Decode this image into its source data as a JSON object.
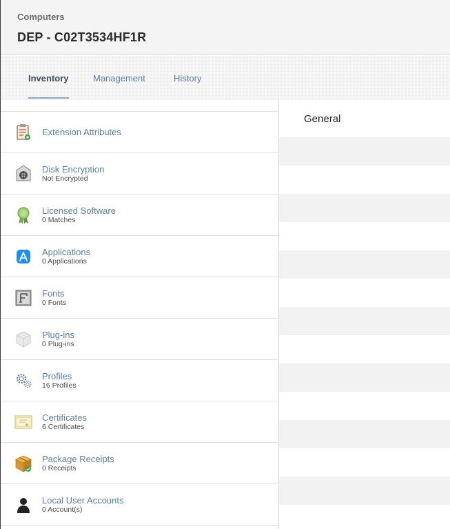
{
  "header": {
    "breadcrumb": "Computers",
    "title": "DEP - C02T3534HF1R"
  },
  "tabs": [
    {
      "label": "Inventory",
      "active": true
    },
    {
      "label": "Management",
      "active": false
    },
    {
      "label": "History",
      "active": false
    }
  ],
  "sidebar": {
    "items": [
      {
        "label": "Extension Attributes",
        "sub": "",
        "icon": "clipboard-add-icon"
      },
      {
        "label": "Disk Encryption",
        "sub": "Not Encrypted",
        "icon": "disk-vault-icon"
      },
      {
        "label": "Licensed Software",
        "sub": "0 Matches",
        "icon": "award-ribbon-icon"
      },
      {
        "label": "Applications",
        "sub": "0 Applications",
        "icon": "app-store-icon"
      },
      {
        "label": "Fonts",
        "sub": "0 Fonts",
        "icon": "font-icon"
      },
      {
        "label": "Plug-ins",
        "sub": "0 Plug-ins",
        "icon": "plugin-cube-icon"
      },
      {
        "label": "Profiles",
        "sub": "16 Profiles",
        "icon": "gears-icon"
      },
      {
        "label": "Certificates",
        "sub": "6 Certificates",
        "icon": "certificate-icon"
      },
      {
        "label": "Package Receipts",
        "sub": "0 Receipts",
        "icon": "package-icon"
      },
      {
        "label": "Local User Accounts",
        "sub": "0 Account(s)",
        "icon": "user-silhouette-icon"
      }
    ]
  },
  "content": {
    "section_title": "General"
  }
}
